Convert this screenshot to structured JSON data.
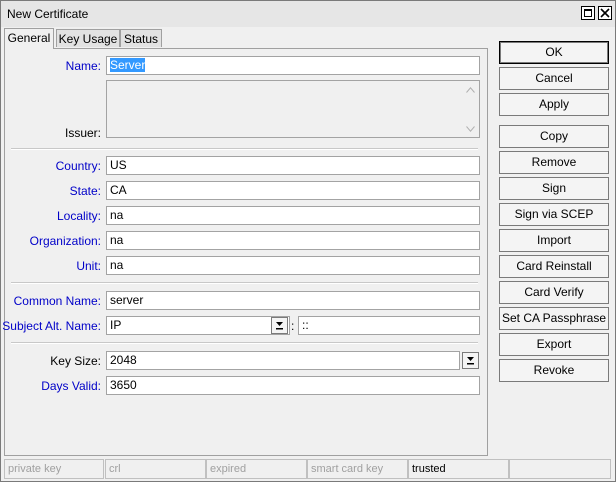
{
  "window": {
    "title": "New Certificate"
  },
  "tabs": [
    "General",
    "Key Usage",
    "Status"
  ],
  "form": {
    "name": {
      "label": "Name:",
      "value": "Server"
    },
    "issuer": {
      "label": "Issuer:"
    },
    "country": {
      "label": "Country:",
      "value": "US"
    },
    "state": {
      "label": "State:",
      "value": "CA"
    },
    "locality": {
      "label": "Locality:",
      "value": "na"
    },
    "organization": {
      "label": "Organization:",
      "value": "na"
    },
    "unit": {
      "label": "Unit:",
      "value": "na"
    },
    "common_name": {
      "label": "Common Name:",
      "value": "server"
    },
    "subject_alt_name": {
      "label": "Subject Alt. Name:",
      "type": "IP",
      "separator": ":",
      "value": "::"
    },
    "key_size": {
      "label": "Key Size:",
      "value": "2048"
    },
    "days_valid": {
      "label": "Days Valid:",
      "value": "3650"
    }
  },
  "buttons": [
    "OK",
    "Cancel",
    "Apply",
    "Copy",
    "Remove",
    "Sign",
    "Sign via SCEP",
    "Import",
    "Card Reinstall",
    "Card Verify",
    "Set CA Passphrase",
    "Export",
    "Revoke"
  ],
  "status": [
    "private key",
    "crl",
    "expired",
    "smart card key",
    "trusted",
    ""
  ],
  "colors": {
    "label_blue": "#0000c8",
    "selection": "#3399ff"
  }
}
